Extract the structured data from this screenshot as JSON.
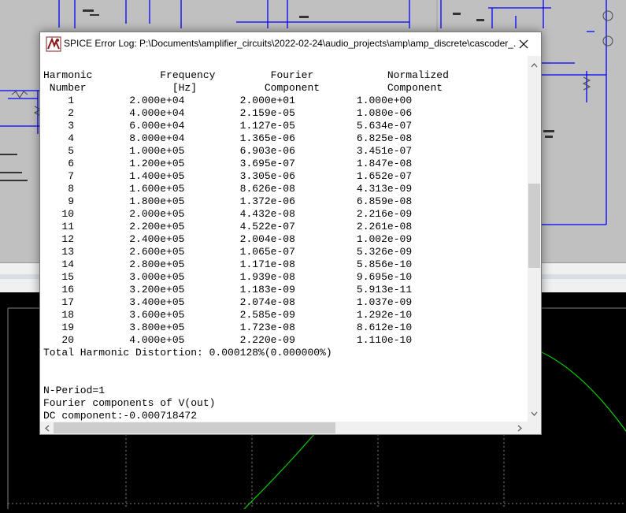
{
  "dialog": {
    "title": "SPICE Error Log: P:\\Documents\\amplifier_circuits\\2022-02-24\\audio_projects\\amp\\amp_discrete\\cascoder_..."
  },
  "log": {
    "header_line1": "Harmonic           Frequency         Fourier            Normalized",
    "header_line2": " Number              [Hz]           Component           Component",
    "rows": [
      [
        "1",
        "2.000e+04",
        "2.000e+01",
        "1.000e+00"
      ],
      [
        "2",
        "4.000e+04",
        "2.159e-05",
        "1.080e-06"
      ],
      [
        "3",
        "6.000e+04",
        "1.127e-05",
        "5.634e-07"
      ],
      [
        "4",
        "8.000e+04",
        "1.365e-06",
        "6.825e-08"
      ],
      [
        "5",
        "1.000e+05",
        "6.903e-06",
        "3.451e-07"
      ],
      [
        "6",
        "1.200e+05",
        "3.695e-07",
        "1.847e-08"
      ],
      [
        "7",
        "1.400e+05",
        "3.305e-06",
        "1.652e-07"
      ],
      [
        "8",
        "1.600e+05",
        "8.626e-08",
        "4.313e-09"
      ],
      [
        "9",
        "1.800e+05",
        "1.372e-06",
        "6.859e-08"
      ],
      [
        "10",
        "2.000e+05",
        "4.432e-08",
        "2.216e-09"
      ],
      [
        "11",
        "2.200e+05",
        "4.522e-07",
        "2.261e-08"
      ],
      [
        "12",
        "2.400e+05",
        "2.004e-08",
        "1.002e-09"
      ],
      [
        "13",
        "2.600e+05",
        "1.065e-07",
        "5.326e-09"
      ],
      [
        "14",
        "2.800e+05",
        "1.171e-08",
        "5.856e-10"
      ],
      [
        "15",
        "3.000e+05",
        "1.939e-08",
        "9.695e-10"
      ],
      [
        "16",
        "3.200e+05",
        "1.183e-09",
        "5.913e-11"
      ],
      [
        "17",
        "3.400e+05",
        "2.074e-08",
        "1.037e-09"
      ],
      [
        "18",
        "3.600e+05",
        "2.585e-09",
        "1.292e-10"
      ],
      [
        "19",
        "3.800e+05",
        "1.723e-08",
        "8.612e-10"
      ],
      [
        "20",
        "4.000e+05",
        "2.220e-09",
        "1.110e-10"
      ]
    ],
    "thd_line": "Total Harmonic Distortion: 0.000128%(0.000000%)",
    "nperiod_line": "N-Period=1",
    "fourier_line": "Fourier components of V(out)",
    "dc_line": "DC component:-0.000718472"
  },
  "colors": {
    "schematic_bg": "#c0c0c0",
    "wire": "#0000ff",
    "plot_bg": "#000000",
    "trace_green": "#00d000"
  },
  "icons": {
    "title": "ltspice-icon",
    "close": "close-icon"
  }
}
